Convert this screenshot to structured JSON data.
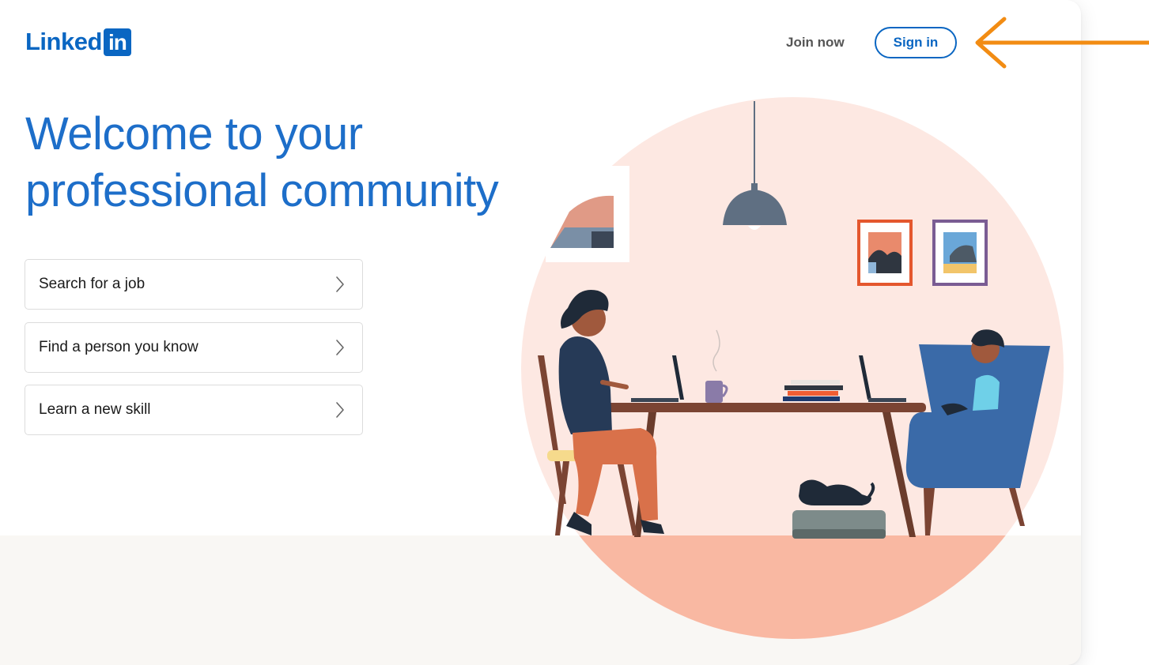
{
  "header": {
    "logo_text": "Linked",
    "logo_box_text": "in",
    "join_now_label": "Join now",
    "sign_in_label": "Sign in"
  },
  "hero": {
    "headline_line1": "Welcome to your",
    "headline_line2": "professional community"
  },
  "options": [
    {
      "label": "Search for a job",
      "icon": "chevron-right-icon"
    },
    {
      "label": "Find a person you know",
      "icon": "chevron-right-icon"
    },
    {
      "label": "Learn a new skill",
      "icon": "chevron-right-icon"
    }
  ],
  "annotation": {
    "icon": "arrow-left-icon",
    "color": "#f28c13"
  },
  "colors": {
    "brand": "#0a66c2",
    "headline": "#1d6ec9",
    "illustration_bg": "#fde8e2",
    "illustration_floor": "#f9b8a2"
  }
}
